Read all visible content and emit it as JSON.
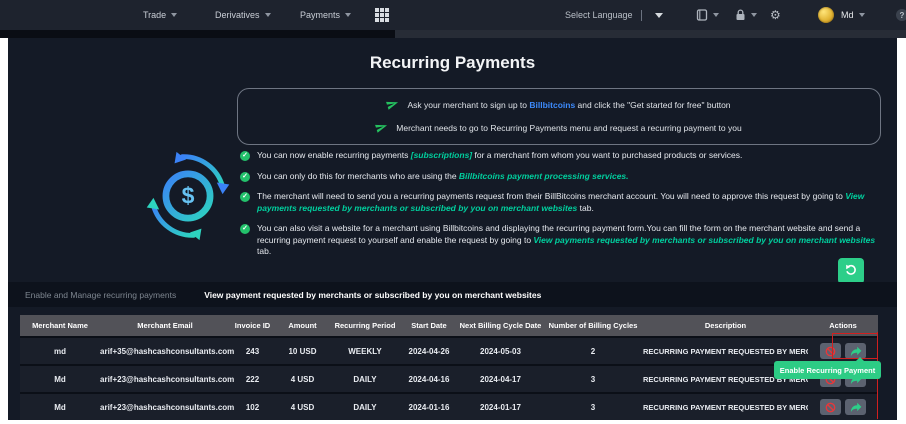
{
  "navbar": {
    "menus": [
      {
        "label": "Trade"
      },
      {
        "label": "Derivatives"
      },
      {
        "label": "Payments"
      }
    ],
    "language_label": "Select Language",
    "user_name": "Md"
  },
  "page_title": "Recurring Payments",
  "info_box": {
    "line1": {
      "pre": "Ask your merchant to sign up to ",
      "link": "Billbitcoins",
      "post": " and click the \"Get started for free\" button"
    },
    "line2": "Merchant needs to go to Recurring Payments menu and request a recurring payment to you"
  },
  "bullets": [
    {
      "pre": "You can now enable recurring payments ",
      "em": "[subscriptions]",
      "post": " for a merchant from whom you want to purchased products or services."
    },
    {
      "pre": "You can only do this for merchants who are using the ",
      "em": "Billbitcoins payment processing services.",
      "post": ""
    },
    {
      "pre": "The merchant will need to send you a recurring payments request from their BillBitcoins merchant account. You will need to approve this request by going to ",
      "em": "View payments requested by merchants or subscribed by you on merchant websites",
      "post": " tab."
    },
    {
      "pre": "You can also visit a website for a merchant using Billbitcoins and displaying the recurring payment form.You can fill the form on the merchant website and send a recurring payment request to yourself and enable the request by going to ",
      "em": "View payments requested by merchants or subscribed by you on merchant websites",
      "post": " tab."
    }
  ],
  "tabs": [
    {
      "label": "Enable and Manage recurring payments",
      "active": false
    },
    {
      "label": "View payment requested by merchants or subscribed by you on merchant websites",
      "active": true
    }
  ],
  "table": {
    "headers": [
      "Merchant Name",
      "Merchant Email",
      "Invoice ID",
      "Amount",
      "Recurring Period",
      "Start Date",
      "Next Billing Cycle Date",
      "Number of Billing Cycles",
      "Description",
      "Actions"
    ],
    "rows": [
      {
        "merchant_name": "md",
        "merchant_email": "arif+35@hashcashconsultants.com",
        "invoice_id": "243",
        "amount": "10 USD",
        "recurring_period": "WEEKLY",
        "start_date": "2024-04-26",
        "next_billing_cycle_date": "2024-05-03",
        "number_of_billing_cycles": "2",
        "description": "RECURRING PAYMENT REQUESTED BY MERCHANT"
      },
      {
        "merchant_name": "Md",
        "merchant_email": "arif+23@hashcashconsultants.com",
        "invoice_id": "222",
        "amount": "4 USD",
        "recurring_period": "DAILY",
        "start_date": "2024-04-16",
        "next_billing_cycle_date": "2024-04-17",
        "number_of_billing_cycles": "3",
        "description": "RECURRING PAYMENT REQUESTED BY MERCHANT"
      },
      {
        "merchant_name": "Md",
        "merchant_email": "arif+23@hashcashconsultants.com",
        "invoice_id": "102",
        "amount": "4 USD",
        "recurring_period": "DAILY",
        "start_date": "2024-01-16",
        "next_billing_cycle_date": "2024-01-17",
        "number_of_billing_cycles": "3",
        "description": "RECURRING PAYMENT REQUESTED BY MERCHANT"
      }
    ]
  },
  "tooltip_label": "Enable Recurring Payment",
  "icons": {
    "dollar": "$",
    "help": "?",
    "check": "✓",
    "gear": "⚙"
  },
  "colors": {
    "accent_green": "#2dce89",
    "teal_text": "#00cf9e",
    "link_blue": "#3d8bfd",
    "danger_red": "#e5383b",
    "navbar_bg": "#1e232e",
    "panel_bg": "#141a26",
    "header_gray": "#525258"
  }
}
